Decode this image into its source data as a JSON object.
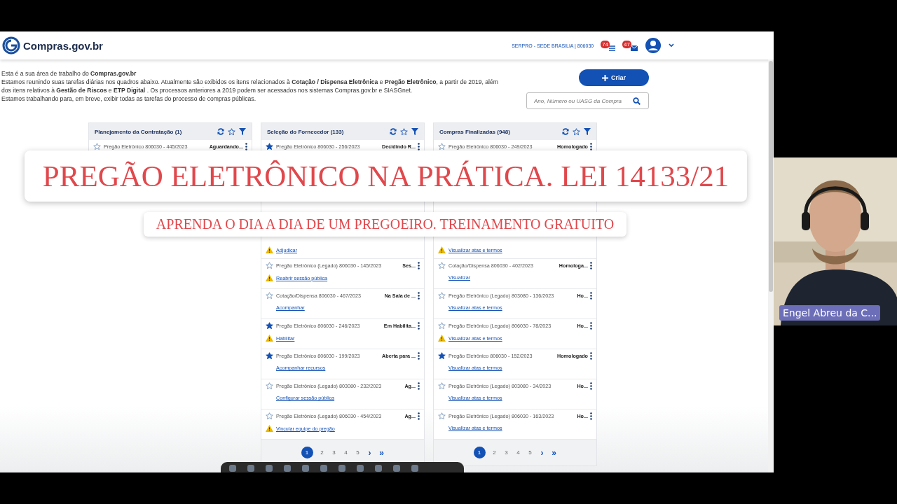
{
  "header": {
    "logo": "Compras.gov.br",
    "unit": "SERPRO - SEDE BRASILIA | 806030",
    "notifications": "74",
    "messages": "47"
  },
  "intro": {
    "lines": [
      "Esta é a sua área de trabalho do **Compras.gov.br**",
      "Estamos reunindo suas tarefas diárias nos quadros abaixo. Atualmente são exibidos os itens relacionados à **Cotação / Dispensa Eletrônica** e **Pregão Eletrônico**, a partir de 2019, além dos itens relativos à **Gestão de Riscos** e **ETP Digital** . Os processos anteriores a 2019 podem ser acessados nos sistemas Compras.gov.br e SIASGnet.",
      "Estamos trabalhando para, em breve, exibir todas as tarefas do processo de compras públicas."
    ]
  },
  "create_button": "Criar",
  "search": {
    "placeholder": "Ano, Número ou UASG da Compra"
  },
  "columns": [
    {
      "title": "Planejamento da Contratação (1)",
      "rows": [
        {
          "starred": false,
          "title": "Pregão Eletrônico 806030 - 445/2023",
          "status": "Aguardando..."
        }
      ]
    },
    {
      "title": "Seleção do Fornecedor (133)",
      "rows": [
        {
          "starred": true,
          "title": "Pregão Eletrônico 806030 - 256/2023",
          "status": "Decidindo R..."
        },
        {
          "action": "Adjudicar",
          "warning": true
        },
        {
          "starred": false,
          "title": "Pregão Eletrônico (Legado) 806030 - 145/2023",
          "status": "Ses...",
          "action": "Reabrir sessão pública",
          "warning": true
        },
        {
          "starred": false,
          "title": "Cotação/Dispensa 806030 - 467/2023",
          "status": "Na Sala de ...",
          "action": "Acompanhar",
          "warning": false
        },
        {
          "starred": true,
          "title": "Pregão Eletrônico 806030 - 246/2023",
          "status": "Em Habilita...",
          "action": "Habilitar",
          "warning": true
        },
        {
          "starred": true,
          "title": "Pregão Eletrônico 806030 - 199/2023",
          "status": "Aberta para ...",
          "action": "Acompanhar recursos",
          "warning": false
        },
        {
          "starred": false,
          "title": "Pregão Eletrônico (Legado) 803080 - 232/2023",
          "status": "Ag...",
          "action": "Configurar sessão pública",
          "warning": false
        },
        {
          "starred": false,
          "title": "Pregão Eletrônico (Legado) 806030 - 454/2023",
          "status": "Ag...",
          "action": "Vincular equipe do pregão",
          "warning": true
        }
      ],
      "pages": [
        {
          "label": "1",
          "selected": true
        },
        {
          "label": "2",
          "selected": false
        },
        {
          "label": "3",
          "selected": false
        },
        {
          "label": "4",
          "selected": false
        },
        {
          "label": "5",
          "selected": false
        }
      ],
      "next": "›",
      "last": "»"
    },
    {
      "title": "Compras Finalizadas (948)",
      "rows": [
        {
          "starred": false,
          "title": "Pregão Eletrônico 806030 - 249/2023",
          "status": "Homologado"
        },
        {
          "action": "Visualizar atas e termos",
          "warning": true
        },
        {
          "starred": false,
          "title": "Cotação/Dispensa 806030 - 402/2023",
          "status": "Homologa...",
          "action": "Visualizar",
          "warning": false
        },
        {
          "starred": false,
          "title": "Pregão Eletrônico (Legado) 803080 - 136/2023",
          "status": "Ho...",
          "action": "Visualizar atas e termos",
          "warning": false
        },
        {
          "starred": false,
          "title": "Pregão Eletrônico (Legado) 806030 - 78/2023",
          "status": "Ho...",
          "action": "Visualizar atas e termos",
          "warning": true
        },
        {
          "starred": true,
          "title": "Pregão Eletrônico 806030 - 152/2023",
          "status": "Homologado",
          "action": "Visualizar atas e termos",
          "warning": false
        },
        {
          "starred": false,
          "title": "Pregão Eletrônico (Legado) 803080 - 34/2023",
          "status": "Ho...",
          "action": "Visualizar atas e termos",
          "warning": false
        },
        {
          "starred": false,
          "title": "Pregão Eletrônico (Legado) 806030 - 163/2023",
          "status": "Ho...",
          "action": "Visualizar atas e termos",
          "warning": false
        }
      ],
      "pages": [
        {
          "label": "1",
          "selected": true
        },
        {
          "label": "2",
          "selected": false
        },
        {
          "label": "3",
          "selected": false
        },
        {
          "label": "4",
          "selected": false
        },
        {
          "label": "5",
          "selected": false
        }
      ],
      "next": "›",
      "last": "»"
    }
  ],
  "overlay": {
    "title": "PREGÃO ELETRÔNICO NA PRÁTICA. LEI 14133/21",
    "subtitle": "APRENDA O DIA A DIA DE UM PREGOEIRO. TREINAMENTO GRATUITO"
  },
  "video": {
    "participant": "Engel Abreu da C..."
  }
}
